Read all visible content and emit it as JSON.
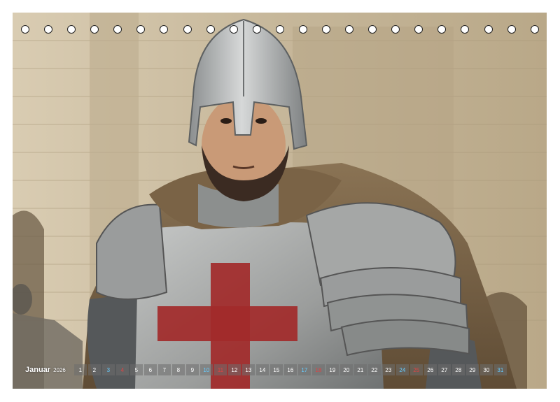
{
  "calendar": {
    "month": "Januar",
    "year": "2026",
    "days": [
      "1",
      "2",
      "3",
      "4",
      "5",
      "6",
      "7",
      "8",
      "9",
      "10",
      "11",
      "12",
      "13",
      "14",
      "15",
      "16",
      "17",
      "18",
      "19",
      "20",
      "21",
      "22",
      "23",
      "24",
      "25",
      "26",
      "27",
      "28",
      "29",
      "30",
      "31"
    ],
    "weekend": {
      "saturdays": [
        "3",
        "10",
        "17",
        "24",
        "31"
      ],
      "sundays": [
        "4",
        "11",
        "18",
        "25"
      ]
    }
  },
  "photo": {
    "subject": "",
    "colors": {
      "wall": "#cdbfa6",
      "armor": "#9a9c9c",
      "cross": "#a22a2a",
      "cloak": "#7d6649"
    }
  },
  "binding": {
    "hole_count": 23
  }
}
